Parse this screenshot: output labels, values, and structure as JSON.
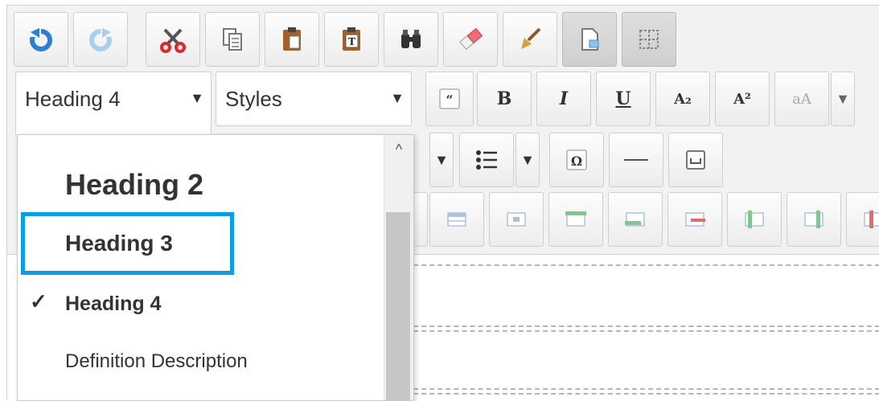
{
  "toolbar": {
    "row1": [
      {
        "name": "undo-button",
        "icon": "undo-icon"
      },
      {
        "name": "redo-button",
        "icon": "redo-icon"
      },
      {
        "name": "cut-button",
        "icon": "scissors-icon"
      },
      {
        "name": "copy-button",
        "icon": "copy-icon"
      },
      {
        "name": "paste-button",
        "icon": "clipboard-icon"
      },
      {
        "name": "paste-text-button",
        "icon": "clipboard-text-icon"
      },
      {
        "name": "find-button",
        "icon": "binoculars-icon"
      },
      {
        "name": "remove-format-button",
        "icon": "eraser-icon"
      },
      {
        "name": "copy-formatting-button",
        "icon": "paintbrush-icon"
      },
      {
        "name": "preview-button",
        "icon": "document-preview-icon"
      },
      {
        "name": "show-blocks-button",
        "icon": "blocks-grid-icon"
      }
    ],
    "format_combo": {
      "value": "Heading 4"
    },
    "styles_combo": {
      "value": "Styles"
    },
    "row2_buttons": {
      "blockquote": "“",
      "bold": "B",
      "italic": "I",
      "underline": "U",
      "subscript": "A₂",
      "superscript": "A²",
      "font_size": "aA"
    },
    "row3_buttons": {
      "special_char": "Ω"
    }
  },
  "format_dropdown": {
    "items": [
      {
        "label": "Heading 2"
      },
      {
        "label": "Heading 3"
      },
      {
        "label": "Heading 4"
      },
      {
        "label": "Definition Description"
      }
    ],
    "selected_index": 2,
    "focused_index": 1,
    "check_glyph": "✓",
    "scroll_up_glyph": "^"
  },
  "colors": {
    "focus_ring": "#0a9fe3",
    "toolbar_bg": "#f2f2f2",
    "button_border": "#cfcfcf"
  }
}
